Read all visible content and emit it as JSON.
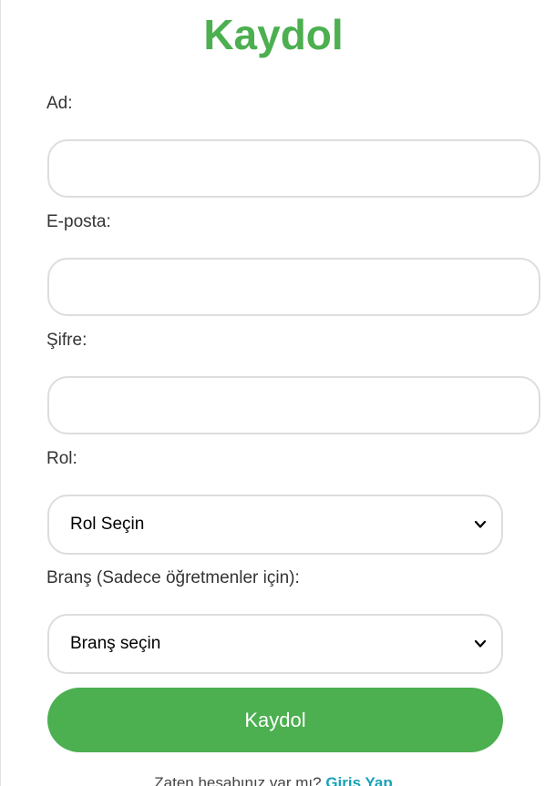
{
  "form": {
    "title": "Kaydol",
    "name_label": "Ad:",
    "name_value": "",
    "email_label": "E-posta:",
    "email_value": "",
    "password_label": "Şifre:",
    "password_value": "",
    "role_label": "Rol:",
    "role_selected": "Rol Seçin",
    "branch_label": "Branş (Sadece öğretmenler için):",
    "branch_selected": "Branş seçin",
    "submit_label": "Kaydol"
  },
  "footer": {
    "prompt": "Zaten hesabınız var mı?",
    "login_link": "Giriş Yap"
  },
  "colors": {
    "accent": "#4caf50",
    "link": "#17a2b8",
    "border": "#dddddd"
  },
  "icons": {
    "select_arrow": "chevron-down-icon"
  }
}
